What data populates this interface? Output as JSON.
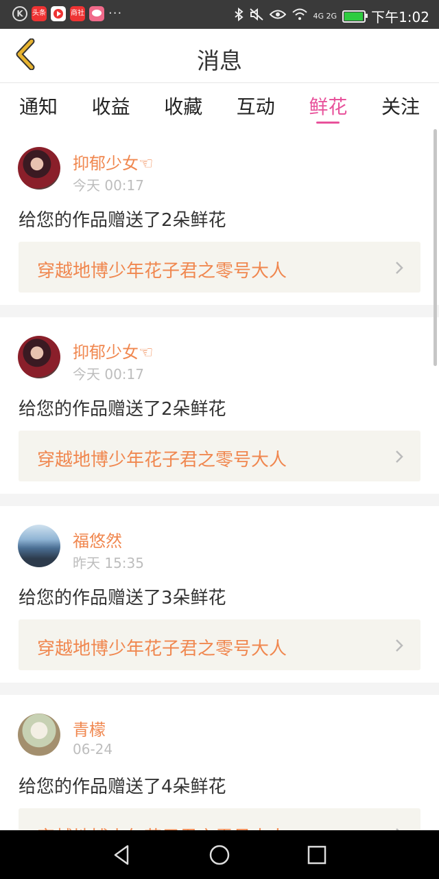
{
  "status_bar": {
    "left_icons": [
      "k-circle-icon",
      "toutiao-app-icon",
      "video-app-icon",
      "shop-app-icon",
      "message-app-icon"
    ],
    "toutiao_label": "头条",
    "shop_label": "商社",
    "more": "···",
    "network": "4G 2G",
    "time": "下午1:02"
  },
  "header": {
    "title": "消息"
  },
  "tabs": [
    {
      "label": "通知"
    },
    {
      "label": "收益"
    },
    {
      "label": "收藏"
    },
    {
      "label": "互动"
    },
    {
      "label": "鲜花",
      "active": true
    },
    {
      "label": "关注"
    }
  ],
  "messages": [
    {
      "user": "抑郁少女☜",
      "time": "今天 00:17",
      "text": "给您的作品赠送了2朵鲜花",
      "work": "穿越地博少年花子君之零号大人"
    },
    {
      "user": "抑郁少女☜",
      "time": "今天 00:17",
      "text": "给您的作品赠送了2朵鲜花",
      "work": "穿越地博少年花子君之零号大人"
    },
    {
      "user": "福悠然",
      "time": "昨天 15:35",
      "text": "给您的作品赠送了3朵鲜花",
      "work": "穿越地博少年花子君之零号大人"
    },
    {
      "user": "青檬",
      "time": "06-24",
      "text": "给您的作品赠送了4朵鲜花",
      "work": "穿越地博少年花子君之零号大人"
    }
  ],
  "colors": {
    "accent": "#e8529b",
    "orange": "#f0874f",
    "back_arrow": "#e7b32f"
  }
}
